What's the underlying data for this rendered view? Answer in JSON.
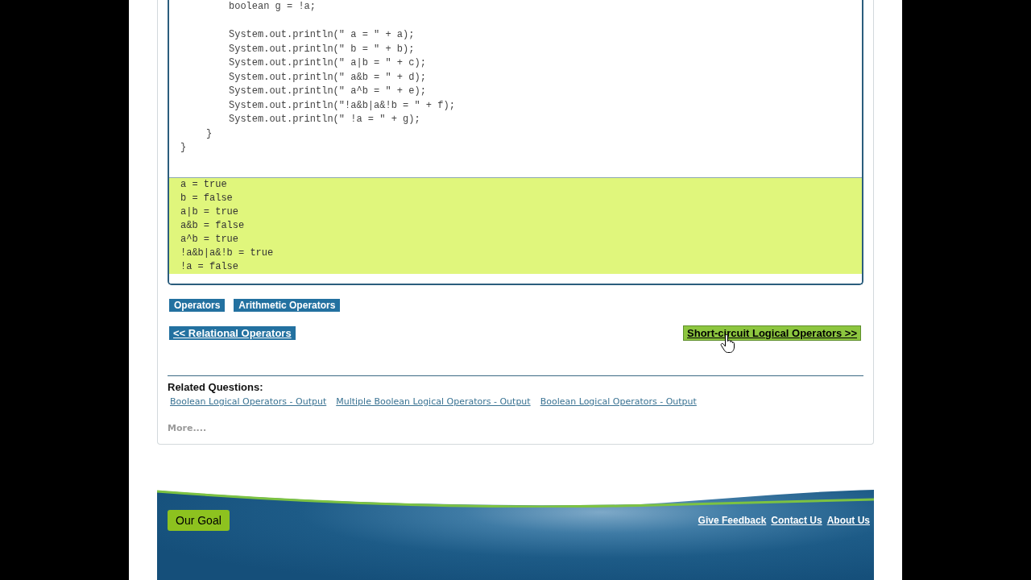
{
  "code_panel": {
    "method_body": [
      [
        "boolean g = !a;"
      ],
      [
        "System.out.println(\" a = \" + a);",
        "System.out.println(\" b = \" + b);",
        "System.out.println(\" a|b = \" + c);",
        "System.out.println(\" a&b = \" + d);",
        "System.out.println(\" a^b = \" + e);",
        "System.out.println(\"!a&b|a&!b = \" + f);",
        "System.out.println(\" !a = \" + g);"
      ]
    ],
    "method_close": "}",
    "class_close": "}",
    "output_lines": [
      "a = true",
      "b = false",
      "a|b = true",
      "a&b = false",
      "a^b = true",
      "!a&b|a&!b = true",
      "!a = false"
    ]
  },
  "tags": [
    "Operators",
    "Arithmetic Operators"
  ],
  "navigation": {
    "previous": "<< Relational Operators",
    "next": "Short-circuit Logical Operators >>"
  },
  "related_questions": {
    "heading": "Related Questions:",
    "links": [
      "Boolean Logical Operators - Output",
      "Multiple Boolean Logical Operators - Output",
      "Boolean Logical Operators - Output"
    ],
    "more": "More...."
  },
  "footer": {
    "goal_button": "Our Goal",
    "links": [
      "Give Feedback",
      "Contact Us",
      "About Us"
    ]
  }
}
